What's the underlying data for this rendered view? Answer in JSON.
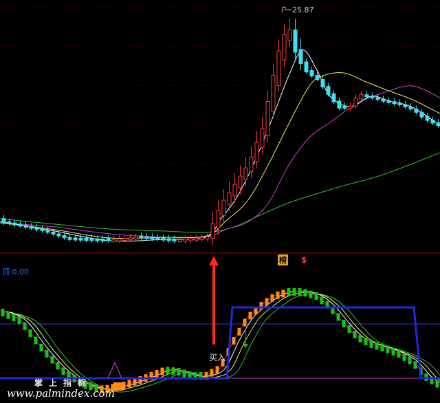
{
  "colors": {
    "background": "#000000",
    "up_candle": "#ff3a3a",
    "down_candle": "#40e0f0",
    "grid_red": "#8a0000",
    "ma5": "#ffffff",
    "ma10": "#f0f060",
    "ma20": "#d040d0",
    "ma60": "#30c030",
    "indicator_blue": "#1e2adf",
    "bar_orange": "#ff8c1a",
    "bar_green": "#18c018",
    "signal_arrow": "#ff2a1a",
    "readout_blue": "#2a6cff"
  },
  "price_panel": {
    "max_price_label": "25.87",
    "icons": [
      "max-marker-icon"
    ]
  },
  "indicator_panel": {
    "readout": "顶 0.00",
    "buy_label": "买入",
    "signal_bang": "榜",
    "signal_dollar": "$",
    "brand_label": "掌上指标",
    "watermark": "www.palmindex.com",
    "icons": [
      "red-up-arrow-icon",
      "green-down-arrow-icon",
      "magenta-peak-icon"
    ]
  }
}
